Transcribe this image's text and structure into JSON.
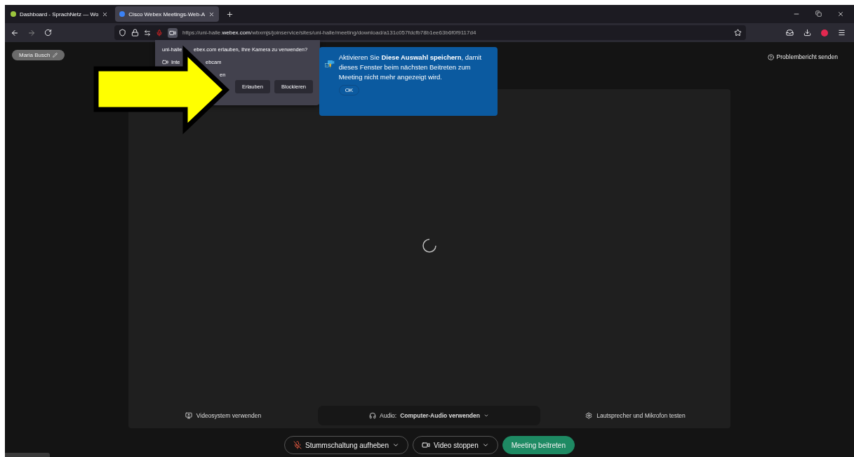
{
  "tabs": [
    {
      "label": "Dashboard - SprachNetz — Wo",
      "selected": false
    },
    {
      "label": "Cisco Webex Meetings-Web-A",
      "selected": true
    }
  ],
  "address_bar": {
    "prefix": "https://uni-halle.",
    "domain": "webex.com",
    "path": "/wbxmjs/joinservice/sites/uni-halle/meeting/download/a131c057fdcfb78b1ee63b6f0f9117d4"
  },
  "permission_popup": {
    "question": [
      "uni-halle",
      "ebex.com erlauben, Ihre Kamera zu verwenden?"
    ],
    "device": [
      "Inte",
      "ebcam"
    ],
    "option": "en",
    "buttons": [
      "Erlauben",
      "Blockieren"
    ]
  },
  "user_name": "Maria Busch",
  "report_link": "Problembericht senden",
  "tip": {
    "text": "Aktivieren Sie **Diese Auswahl speichern**, damit dieses Fenster beim nächsten Beitreten zum Meeting nicht mehr angezeigt wird.",
    "button": "OK"
  },
  "video_options": {
    "video_system": "Videosystem verwenden",
    "audio_label": "Audio:",
    "audio_value": "Computer-Audio verwenden",
    "test": "Lautsprecher und Mikrofon testen"
  },
  "controls": [
    {
      "label": "Stummschaltung aufheben",
      "kind": "mic"
    },
    {
      "label": "Video stoppen",
      "kind": "video"
    },
    {
      "label": "Meeting beitreten",
      "kind": "join"
    }
  ]
}
